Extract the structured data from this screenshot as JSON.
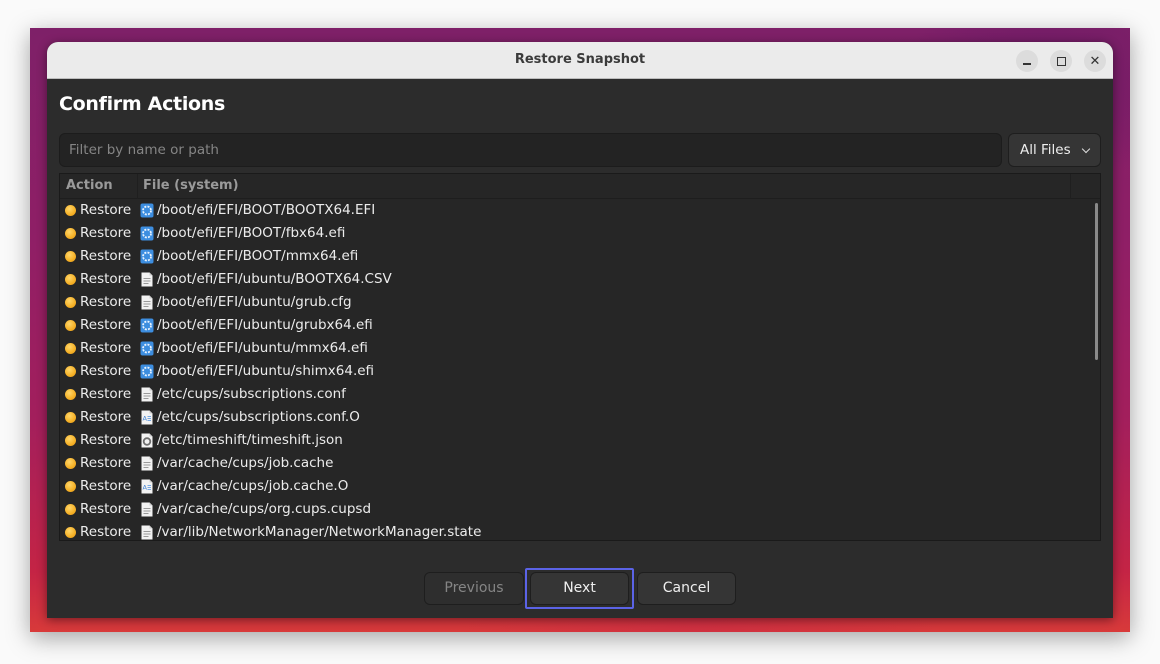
{
  "window": {
    "title": "Restore Snapshot",
    "controls": {
      "minimize": "minimize",
      "maximize": "maximize",
      "close": "close"
    }
  },
  "page": {
    "heading": "Confirm Actions"
  },
  "filter": {
    "value": "",
    "placeholder": "Filter by name or path"
  },
  "file_filter": {
    "selected": "All Files"
  },
  "table": {
    "columns": [
      "Action",
      "File (system)"
    ],
    "rows": [
      {
        "action": "Restore",
        "icon": "executable-gear-icon",
        "path": "/boot/efi/EFI/BOOT/BOOTX64.EFI"
      },
      {
        "action": "Restore",
        "icon": "executable-gear-icon",
        "path": "/boot/efi/EFI/BOOT/fbx64.efi"
      },
      {
        "action": "Restore",
        "icon": "executable-gear-icon",
        "path": "/boot/efi/EFI/BOOT/mmx64.efi"
      },
      {
        "action": "Restore",
        "icon": "text-file-icon",
        "path": "/boot/efi/EFI/ubuntu/BOOTX64.CSV"
      },
      {
        "action": "Restore",
        "icon": "text-file-icon",
        "path": "/boot/efi/EFI/ubuntu/grub.cfg"
      },
      {
        "action": "Restore",
        "icon": "executable-gear-icon",
        "path": "/boot/efi/EFI/ubuntu/grubx64.efi"
      },
      {
        "action": "Restore",
        "icon": "executable-gear-icon",
        "path": "/boot/efi/EFI/ubuntu/mmx64.efi"
      },
      {
        "action": "Restore",
        "icon": "executable-gear-icon",
        "path": "/boot/efi/EFI/ubuntu/shimx64.efi"
      },
      {
        "action": "Restore",
        "icon": "text-file-icon",
        "path": "/etc/cups/subscriptions.conf"
      },
      {
        "action": "Restore",
        "icon": "document-file-icon",
        "path": "/etc/cups/subscriptions.conf.O"
      },
      {
        "action": "Restore",
        "icon": "json-file-icon",
        "path": "/etc/timeshift/timeshift.json"
      },
      {
        "action": "Restore",
        "icon": "text-file-icon",
        "path": "/var/cache/cups/job.cache"
      },
      {
        "action": "Restore",
        "icon": "document-file-icon",
        "path": "/var/cache/cups/job.cache.O"
      },
      {
        "action": "Restore",
        "icon": "text-file-icon",
        "path": "/var/cache/cups/org.cups.cupsd"
      },
      {
        "action": "Restore",
        "icon": "text-file-icon",
        "path": "/var/lib/NetworkManager/NetworkManager.state"
      }
    ]
  },
  "buttons": {
    "previous": "Previous",
    "next": "Next",
    "cancel": "Cancel"
  },
  "colors": {
    "status_dot": "#f5b025",
    "focus_ring": "#5b63e6",
    "window_bg": "#2c2c2c",
    "titlebar_bg": "#ebebeb"
  }
}
